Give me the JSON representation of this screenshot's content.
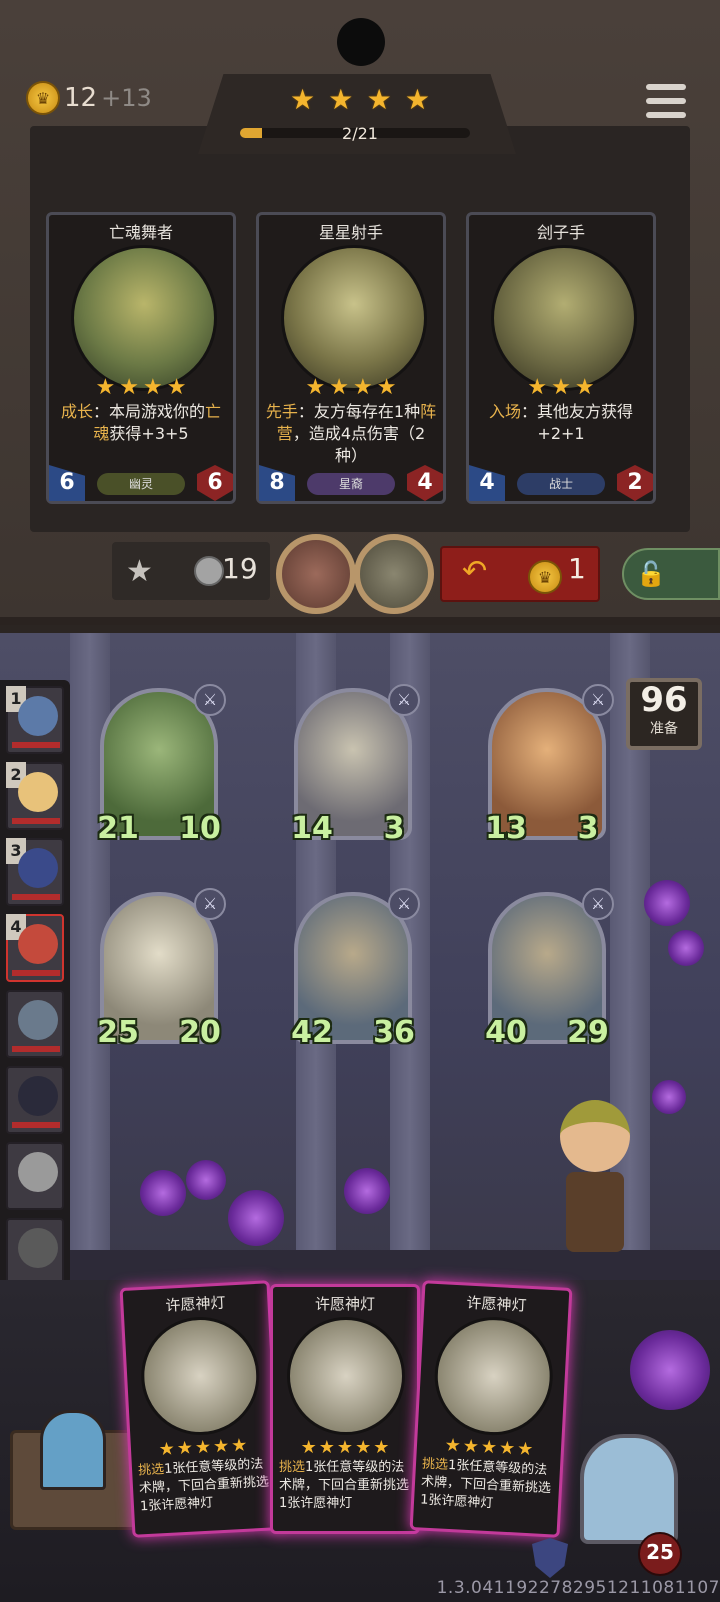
{
  "header": {
    "gold": "12",
    "gold_income": "+13",
    "tier_stars": [
      "★",
      "★",
      "★",
      "★"
    ],
    "xp_text": "2/21",
    "xp_progress": 0.095
  },
  "shop_cards": [
    {
      "name": "亡魂舞者",
      "stars": [
        "★",
        "★",
        "★",
        "★"
      ],
      "desc_key": "成长",
      "desc_text": "：本局游戏你的",
      "desc_key2": "亡魂",
      "desc_text2": "获得+3+5",
      "attack": "6",
      "health": "6",
      "tribe": "幽灵",
      "tribe_color": "#4a5028"
    },
    {
      "name": "星星射手",
      "stars": [
        "★",
        "★",
        "★",
        "★"
      ],
      "desc_key": "先手",
      "desc_text": "：友方每存在1种",
      "desc_key2": "阵营",
      "desc_text2": "，造成4点伤害（2种）",
      "attack": "8",
      "health": "4",
      "tribe": "星裔",
      "tribe_color": "#4d3a6a"
    },
    {
      "name": "刽子手",
      "stars": [
        "★",
        "★",
        "★"
      ],
      "desc_key": "入场",
      "desc_text": "：其他友方获得+2+1",
      "desc_key2": "",
      "desc_text2": "",
      "attack": "4",
      "health": "2",
      "tribe": "战士",
      "tribe_color": "#2d3d66"
    }
  ],
  "actions": {
    "upgrade_cost": "19",
    "refresh_cost": "1"
  },
  "prep": {
    "count": "96",
    "label": "准备"
  },
  "opponents": [
    {
      "rank": "1",
      "name": "opponent-1"
    },
    {
      "rank": "2",
      "name": "opponent-2"
    },
    {
      "rank": "3",
      "name": "opponent-3"
    },
    {
      "rank": "4",
      "name": "opponent-4"
    },
    {
      "rank": "",
      "name": "opponent-5"
    },
    {
      "rank": "",
      "name": "opponent-6"
    },
    {
      "rank": "",
      "name": "opponent-7"
    },
    {
      "rank": "",
      "name": "opponent-8"
    }
  ],
  "board_units": [
    {
      "attack": "21",
      "health": "10"
    },
    {
      "attack": "14",
      "health": "3"
    },
    {
      "attack": "13",
      "health": "3"
    },
    {
      "attack": "25",
      "health": "20"
    },
    {
      "attack": "42",
      "health": "36"
    },
    {
      "attack": "40",
      "health": "29"
    }
  ],
  "hand_cards": [
    {
      "name": "许愿神灯",
      "stars": [
        "★",
        "★",
        "★",
        "★",
        "★"
      ],
      "desc_key": "挑选",
      "desc_text": "1张任意等级的法术牌，下回合重新挑选1张许愿神灯"
    },
    {
      "name": "许愿神灯",
      "stars": [
        "★",
        "★",
        "★",
        "★",
        "★"
      ],
      "desc_key": "挑选",
      "desc_text": "1张任意等级的法术牌，下回合重新挑选1张许愿神灯"
    },
    {
      "name": "许愿神灯",
      "stars": [
        "★",
        "★",
        "★",
        "★",
        "★"
      ],
      "desc_key": "挑选",
      "desc_text": "1张任意等级的法术牌，下回合重新挑选1张许愿神灯"
    }
  ],
  "player": {
    "health": "25"
  },
  "version": "1.3.0411922782951211081107",
  "icons": {
    "coin": "crown-coin-icon",
    "menu": "menu-icon",
    "upgrade": "star-upgrade-icon",
    "refresh": "refresh-arrow-icon",
    "lock": "lock-icon",
    "tribe": "sword-icon",
    "shield": "shield-icon"
  }
}
